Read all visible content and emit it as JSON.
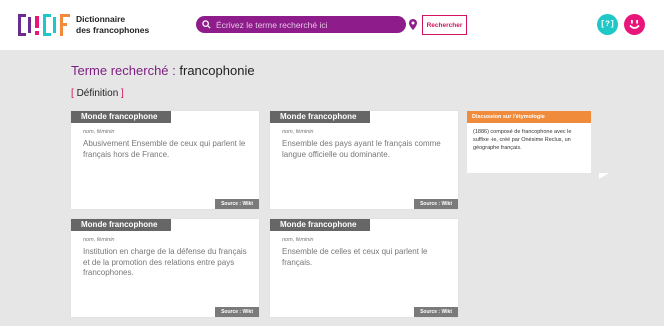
{
  "header": {
    "logo_letters": [
      "D",
      "!",
      "D",
      "F"
    ],
    "site_name_line1": "Dictionnaire",
    "site_name_line2": "des francophones",
    "search": {
      "placeholder": "Écrivez le terme recherché ici",
      "value": ""
    },
    "search_button_label": "Rechercher",
    "help_icon_label": "[?]",
    "colors": {
      "search_bg": "#8e1d8b",
      "accent": "#d3125d",
      "help": "#1fc8c6",
      "smile": "#e8157a"
    }
  },
  "main": {
    "term_label": "Terme recherché :",
    "term_value": "francophonie",
    "section_title": "Définition",
    "cards": [
      {
        "heading": "Monde francophone",
        "type": "nom, féminin",
        "definition": "Abusivement Ensemble de ceux qui parlent le français hors de France.",
        "source": "Source : Wikt"
      },
      {
        "heading": "Monde francophone",
        "type": "nom, féminin",
        "definition": "Ensemble des pays ayant le français comme langue officielle ou dominante.",
        "source": "Source : Wikt"
      },
      {
        "heading": "Monde francophone",
        "type": "nom, féminin",
        "definition": "Institution en charge de la défense du français et de la promotion des relations entre pays francophones.",
        "source": "Source : Wikt"
      },
      {
        "heading": "Monde francophone",
        "type": "nom, féminin",
        "definition": "Ensemble de celles et ceux qui parlent le français.",
        "source": "Source : Wikt"
      }
    ],
    "etymology": {
      "title": "Discussion sur l'étymologie",
      "text": "(1886) composé de francophone avec le suffixe -ie, créé par Onésime Reclus, un géographe français."
    }
  }
}
